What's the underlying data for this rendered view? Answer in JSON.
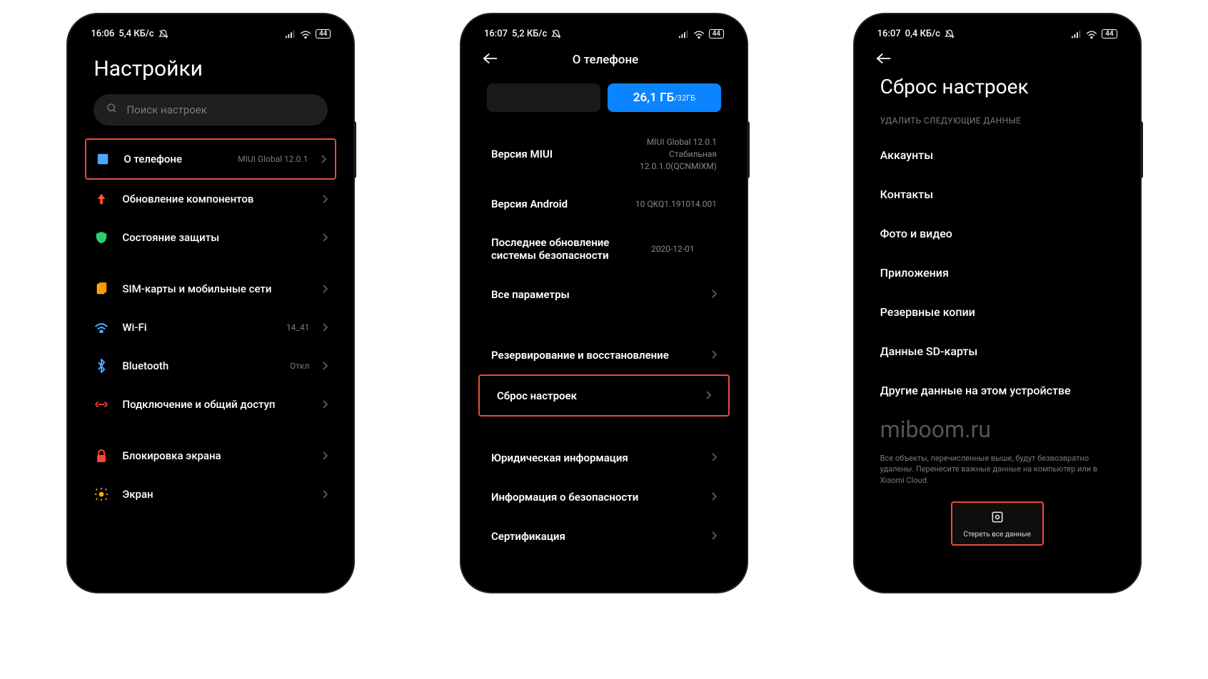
{
  "phone1": {
    "status": {
      "time": "16:06",
      "speed": "5,4 КБ/с",
      "battery": "44"
    },
    "title": "Настройки",
    "search_placeholder": "Поиск настроек",
    "rows": [
      {
        "label": "О телефоне",
        "value": "MIUI Global 12.0.1"
      },
      {
        "label": "Обновление компонентов",
        "value": ""
      },
      {
        "label": "Состояние защиты",
        "value": ""
      },
      {
        "label": "SIM-карты и мобильные сети",
        "value": ""
      },
      {
        "label": "Wi-Fi",
        "value": "14_41"
      },
      {
        "label": "Bluetooth",
        "value": "Откл"
      },
      {
        "label": "Подключение и общий доступ",
        "value": ""
      },
      {
        "label": "Блокировка экрана",
        "value": ""
      },
      {
        "label": "Экран",
        "value": ""
      }
    ]
  },
  "phone2": {
    "status": {
      "time": "16:07",
      "speed": "5,2 КБ/с",
      "battery": "44"
    },
    "title": "О телефоне",
    "storage": {
      "used": "26,1 ГБ",
      "total": "/32ГБ"
    },
    "info": [
      {
        "label": "Версия MIUI",
        "value": "MIUI Global 12.0.1\nСтабильная\n12.0.1.0(QCNMIXM)"
      },
      {
        "label": "Версия Android",
        "value": "10 QKQ1.191014.001"
      },
      {
        "label": "Последнее обновление системы безопасности",
        "value": "2020-12-01"
      }
    ],
    "nav": [
      {
        "label": "Все параметры"
      },
      {
        "label": "Резервирование и восстановление"
      },
      {
        "label": "Сброс настроек"
      },
      {
        "label": "Юридическая информация"
      },
      {
        "label": "Информация о безопасности"
      },
      {
        "label": "Сертификация"
      }
    ]
  },
  "phone3": {
    "status": {
      "time": "16:07",
      "speed": "0,4 КБ/с",
      "battery": "44"
    },
    "title": "Сброс настроек",
    "section": "УДАЛИТЬ СЛЕДУЮЩИЕ ДАННЫЕ",
    "items": [
      "Аккаунты",
      "Контакты",
      "Фото и видео",
      "Приложения",
      "Резервные копии",
      "Данные SD-карты",
      "Другие данные на этом устройстве"
    ],
    "watermark": "miboom.ru",
    "warning": "Все объекты, перечисленные выше, будут безвозвратно удалены. Перенесите важные данные на компьютер или в Xiaomi Cloud.",
    "erase_button": "Стереть все данные"
  }
}
